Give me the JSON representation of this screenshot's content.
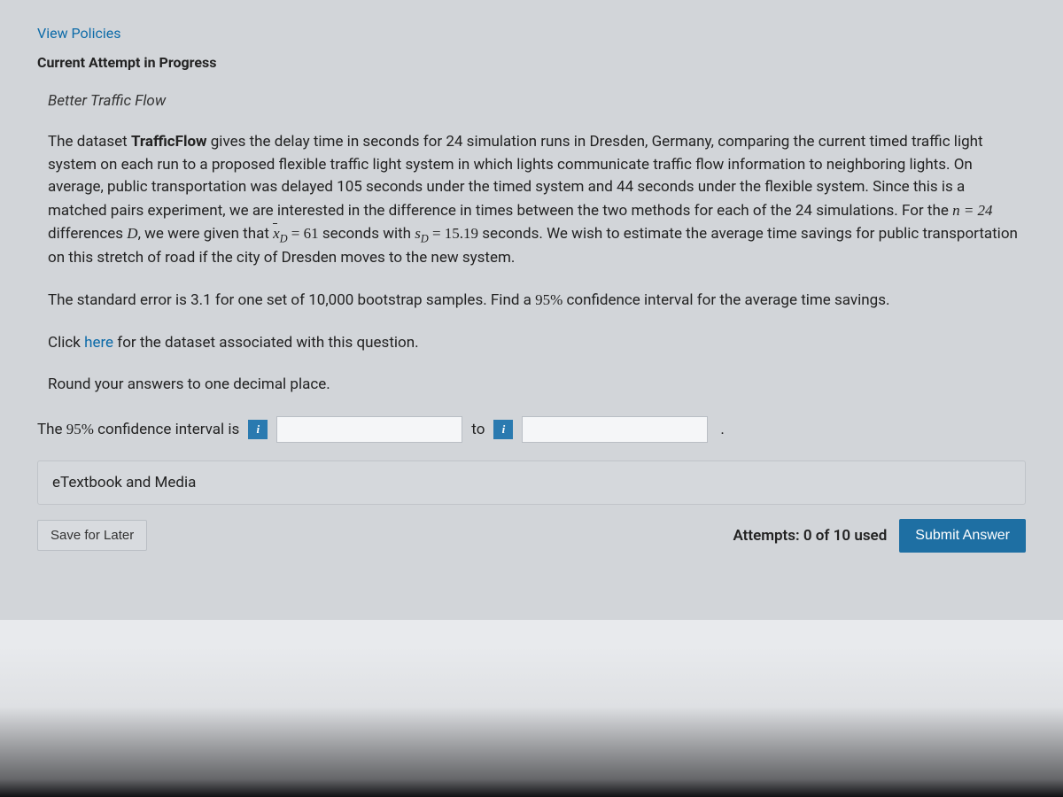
{
  "header": {
    "view_policies": "View Policies",
    "attempt_status": "Current Attempt in Progress"
  },
  "question": {
    "title": "Better Traffic Flow",
    "p1a": "The dataset ",
    "p1bold": "TrafficFlow",
    "p1b": " gives the delay time in seconds for 24 simulation runs in Dresden, Germany, comparing the current timed traffic light system on each run to a proposed flexible traffic light system in which lights communicate traffic flow information to neighboring lights. On average, public transportation was delayed 105 seconds under the timed system and 44 seconds under the flexible system. Since this is a matched pairs experiment, we are interested in the difference in times between the two methods for each of the 24 simulations. For the ",
    "n_eq": "n = 24",
    "p1c": " differences ",
    "D": "D",
    "p1d": ", we were given that ",
    "xbar": "x",
    "xbar_sub": "D",
    "eq61": " = 61",
    "p1e": " seconds with ",
    "s": "s",
    "s_sub": "D",
    "eq1519": " = 15.19",
    "p1f": " seconds. We wish to estimate the average time savings for public transportation on this stretch of road if the city of Dresden moves to the new system.",
    "p2a": "The standard error is 3.1 for one set of 10,000 bootstrap samples. Find a ",
    "p2pct": "95%",
    "p2b": " confidence interval for the average time savings.",
    "p3a": "Click ",
    "p3link": "here",
    "p3b": " for the dataset associated with this question.",
    "p4": "Round your answers to one decimal place.",
    "answer_label_a": "The ",
    "answer_label_pct": "95%",
    "answer_label_b": " confidence interval is",
    "to": "to"
  },
  "resources": {
    "etextbook": "eTextbook and Media"
  },
  "footer": {
    "save": "Save for Later",
    "attempts": "Attempts: 0 of 10 used",
    "submit": "Submit Answer"
  }
}
